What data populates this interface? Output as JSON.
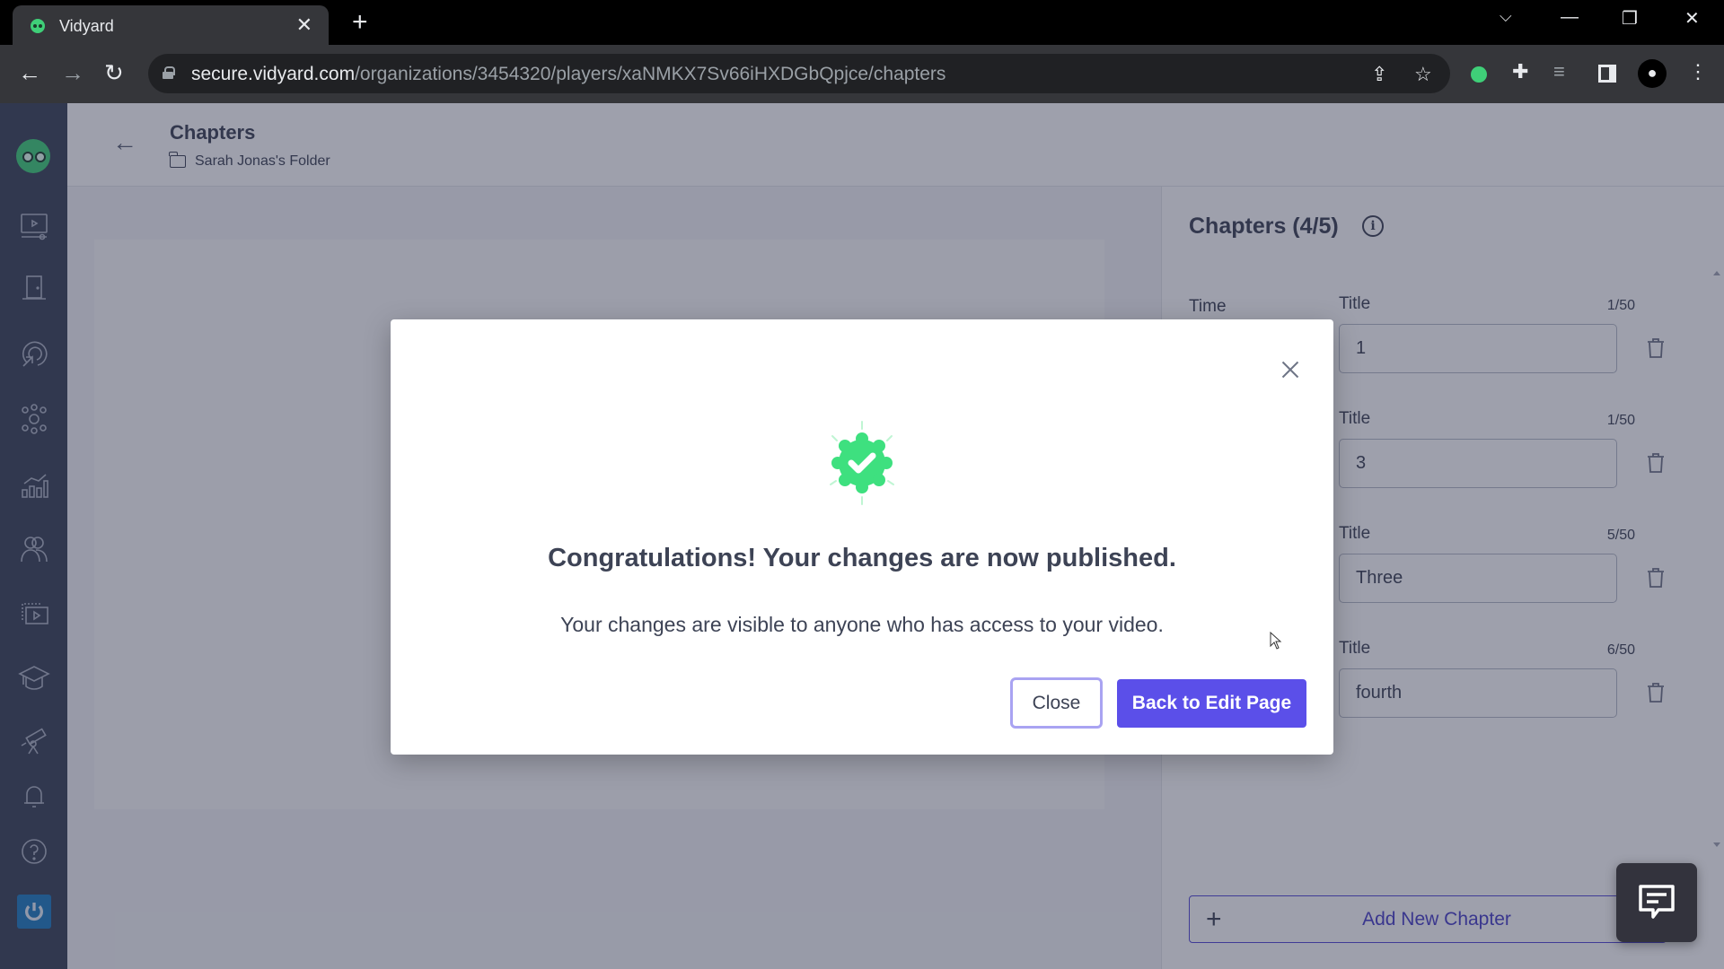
{
  "browser": {
    "tab_title": "Vidyard",
    "url_host": "secure.vidyard.com",
    "url_path": "/organizations/3454320/players/xaNMKX7Sv66iHXDGbQpjce/chapters",
    "icons": [
      "back-arrow-icon",
      "forward-arrow-icon",
      "reload-icon",
      "lock-icon",
      "share-icon",
      "bookmark-star-icon",
      "vidyard-extension-icon",
      "extensions-puzzle-icon",
      "media-control-icon",
      "side-panel-icon",
      "profile-icon",
      "more-menu-icon"
    ]
  },
  "sidebar": {
    "items": [
      {
        "name": "videos",
        "icon": "video-screen-icon"
      },
      {
        "name": "rooms",
        "icon": "door-icon"
      },
      {
        "name": "prospecting",
        "icon": "target-cursor-icon"
      },
      {
        "name": "integrations",
        "icon": "network-nodes-icon"
      },
      {
        "name": "analytics",
        "icon": "bar-chart-icon"
      },
      {
        "name": "team",
        "icon": "users-icon"
      },
      {
        "name": "hubs",
        "icon": "video-library-icon"
      },
      {
        "name": "learn",
        "icon": "graduation-cap-icon"
      },
      {
        "name": "discover",
        "icon": "telescope-icon"
      },
      {
        "name": "notifications",
        "icon": "bell-icon"
      },
      {
        "name": "help",
        "icon": "help-circle-icon"
      },
      {
        "name": "account",
        "icon": "power-icon"
      }
    ]
  },
  "header": {
    "title": "Chapters",
    "folder": "Sarah Jonas's Folder"
  },
  "chapters_panel": {
    "heading": "Chapters (4/5)",
    "time_label": "Time",
    "title_label": "Title",
    "items": [
      {
        "count": "1/50",
        "value": "1"
      },
      {
        "count": "1/50",
        "value": "3"
      },
      {
        "count": "5/50",
        "value": "Three"
      },
      {
        "count": "6/50",
        "value": "fourth"
      }
    ],
    "add_label": "Add New Chapter"
  },
  "modal": {
    "title": "Congratulations! Your changes are now published.",
    "description": "Your changes are visible to anyone who has access to your video.",
    "close_label": "Close",
    "primary_label": "Back to Edit Page"
  },
  "colors": {
    "brand_primary": "#5b4fe9",
    "success_green": "#3ee07f",
    "sidebar_bg": "#394257"
  }
}
